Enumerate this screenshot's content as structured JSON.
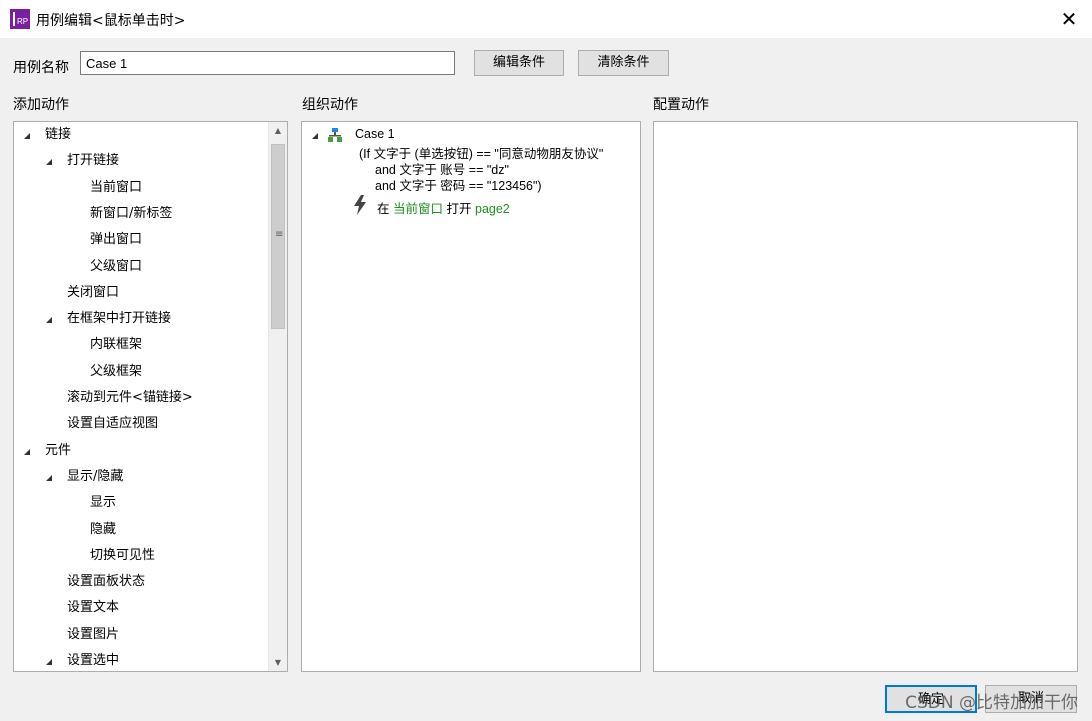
{
  "window": {
    "title": "用例编辑<鼠标单击时>",
    "icon_text": "RP",
    "close_symbol": "✕"
  },
  "case_name": {
    "label": "用例名称",
    "value": "Case 1"
  },
  "buttons": {
    "edit_condition": "编辑条件",
    "clear_condition": "清除条件",
    "ok": "确定",
    "cancel": "取消"
  },
  "sections": {
    "add_actions": "添加动作",
    "organize_actions": "组织动作",
    "configure_actions": "配置动作"
  },
  "action_tree": [
    {
      "label": "链接",
      "level": 0,
      "expanded": true
    },
    {
      "label": "打开链接",
      "level": 1,
      "expanded": true
    },
    {
      "label": "当前窗口",
      "level": 2
    },
    {
      "label": "新窗口/新标签",
      "level": 2
    },
    {
      "label": "弹出窗口",
      "level": 2
    },
    {
      "label": "父级窗口",
      "level": 2
    },
    {
      "label": "关闭窗口",
      "level": 1
    },
    {
      "label": "在框架中打开链接",
      "level": 1,
      "expanded": true
    },
    {
      "label": "内联框架",
      "level": 2
    },
    {
      "label": "父级框架",
      "level": 2
    },
    {
      "label": "滚动到元件<锚链接>",
      "level": 1
    },
    {
      "label": "设置自适应视图",
      "level": 1
    },
    {
      "label": "元件",
      "level": 0,
      "expanded": true
    },
    {
      "label": "显示/隐藏",
      "level": 1,
      "expanded": true
    },
    {
      "label": "显示",
      "level": 2
    },
    {
      "label": "隐藏",
      "level": 2
    },
    {
      "label": "切换可见性",
      "level": 2
    },
    {
      "label": "设置面板状态",
      "level": 1
    },
    {
      "label": "设置文本",
      "level": 1
    },
    {
      "label": "设置图片",
      "level": 1
    },
    {
      "label": "设置选中",
      "level": 1,
      "expanded": true
    }
  ],
  "case": {
    "name": "Case 1",
    "conditions": [
      "(If 文字于 (单选按钮) == \"同意动物朋友协议\"",
      "and 文字于 账号 == \"dz\"",
      "and 文字于 密码 == \"123456\")"
    ],
    "action": {
      "prefix": "在",
      "target": "当前窗口",
      "verb": "打开",
      "page": "page2"
    }
  },
  "watermark": "CSDN @比特加加干你",
  "colors": {
    "accent": "#0078d7",
    "link_green": "#1f8f1f",
    "app_icon": "#7b1fa2"
  }
}
